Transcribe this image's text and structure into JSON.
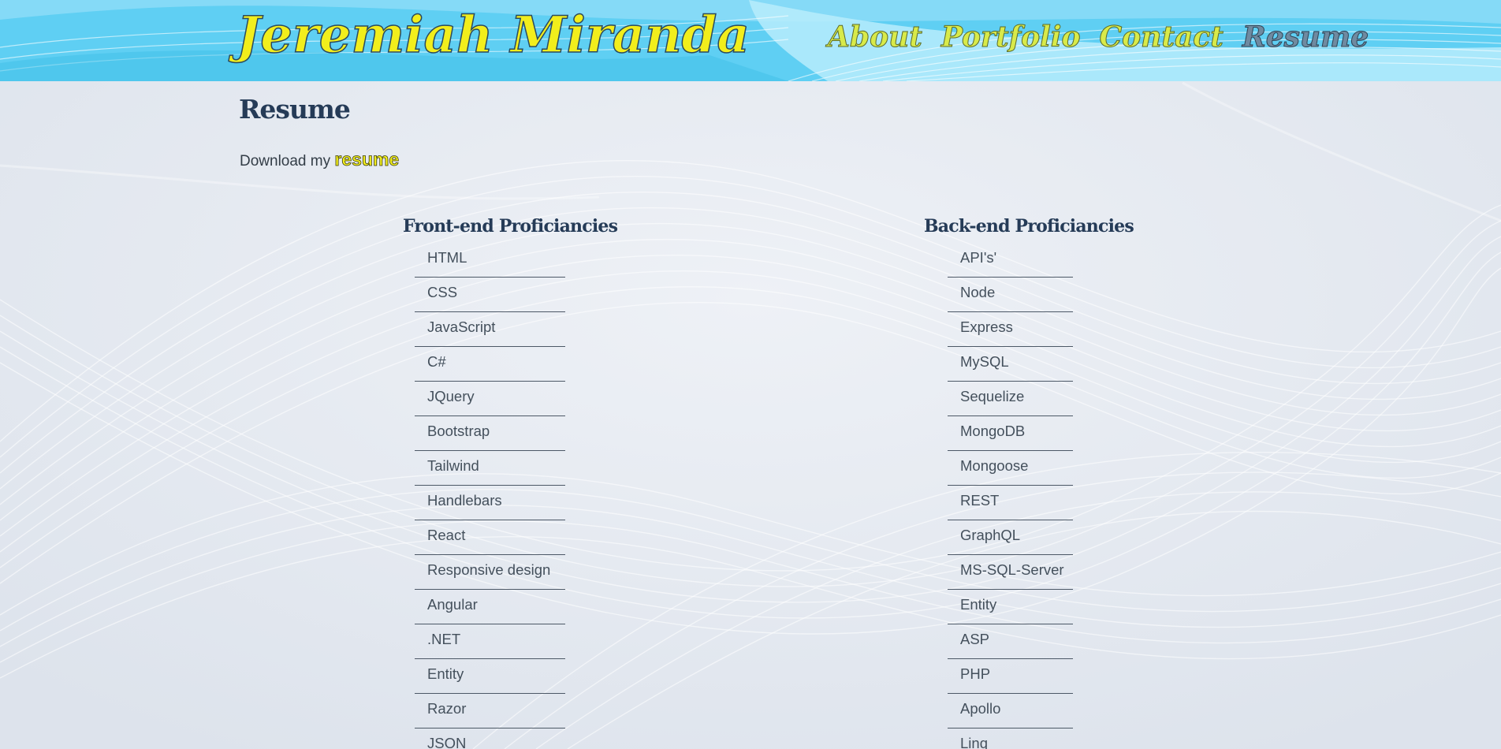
{
  "header": {
    "site_title": "Jeremiah Miranda",
    "nav": [
      {
        "label": "About",
        "active": false
      },
      {
        "label": "Portfolio",
        "active": false
      },
      {
        "label": "Contact",
        "active": false
      },
      {
        "label": "Resume",
        "active": true
      }
    ]
  },
  "main": {
    "heading": "Resume",
    "download_text": "Download my",
    "resume_link": "resume",
    "front_end": {
      "title": "Front-end Proficiancies",
      "items": [
        "HTML",
        "CSS",
        "JavaScript",
        "C#",
        "JQuery",
        "Bootstrap",
        "Tailwind",
        "Handlebars",
        "React",
        "Responsive design",
        "Angular",
        ".NET",
        "Entity",
        "Razor",
        "JSON"
      ]
    },
    "back_end": {
      "title": "Back-end Proficiancies",
      "items": [
        "API's'",
        "Node",
        "Express",
        "MySQL",
        "Sequelize",
        "MongoDB",
        "Mongoose",
        "REST",
        "GraphQL",
        "MS-SQL-Server",
        "Entity",
        "ASP",
        "PHP",
        "Apollo",
        "Linq"
      ]
    }
  },
  "colors": {
    "title_yellow": "#f2ee1c",
    "nav_yellow": "#d8ea4a",
    "nav_active": "#6f8aa0",
    "heading_navy": "#253b57",
    "page_bg": "#e3e8f0",
    "header_blue": "#59cdf2"
  }
}
